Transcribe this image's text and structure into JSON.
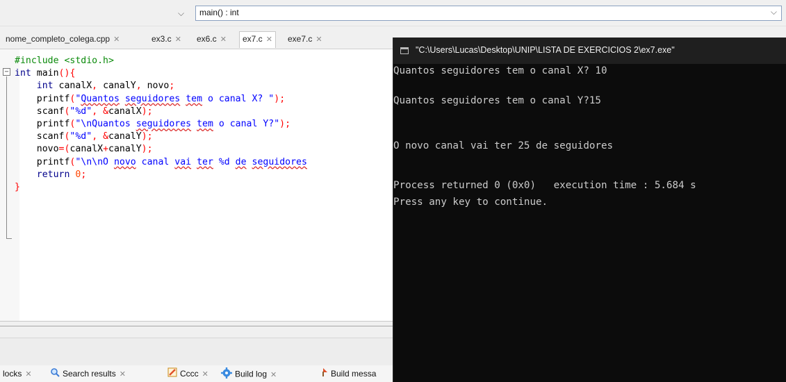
{
  "toolbar": {
    "function_select_value": "main() : int"
  },
  "file_tabs": [
    {
      "label": "nome_completo_colega.cpp",
      "close": "✕"
    },
    {
      "label": "ex3.c",
      "close": "✕"
    },
    {
      "label": "ex6.c",
      "close": "✕"
    },
    {
      "label": "ex7.c",
      "close": "✕",
      "active": true
    },
    {
      "label": "exe7.c",
      "close": "✕"
    }
  ],
  "code_lines": [
    "#include <stdio.h>",
    "int main(){",
    "    int canalX, canalY, novo;",
    "    printf(\"Quantos seguidores tem o canal X? \");",
    "    scanf(\"%d\", &canalX);",
    "    printf(\"\\nQuantos seguidores tem o canal Y?\");",
    "    scanf(\"%d\", &canalY);",
    "    novo=(canalX+canalY);",
    "    printf(\"\\n\\nO novo canal vai ter %d de seguidores",
    "    return 0;",
    "}"
  ],
  "bottom_tabs": [
    {
      "label": "locks",
      "close": "✕",
      "icon": "none"
    },
    {
      "label": "Search results",
      "close": "✕",
      "icon": "search-icon"
    },
    {
      "label": "Cccc",
      "close": "✕",
      "icon": "pencil-icon"
    },
    {
      "label": "Build log",
      "close": "✕",
      "icon": "gear-icon"
    },
    {
      "label": "Build messa",
      "close": "",
      "icon": "build-message-icon"
    }
  ],
  "console": {
    "title": "\"C:\\Users\\Lucas\\Desktop\\UNIP\\LISTA DE EXERCICIOS 2\\ex7.exe\"",
    "lines": [
      "Quantos seguidores tem o canal X? 10",
      "Quantos seguidores tem o canal Y?15",
      "O novo canal vai ter 25 de seguidores",
      "Process returned 0 (0x0)   execution time : 5.684 s",
      "Press any key to continue."
    ]
  },
  "colors": {
    "preprocessor": "#0a8a0a",
    "keyword": "#00008b",
    "string": "#0000ff",
    "number": "#ff4500",
    "console_bg": "#0c0c0c",
    "console_text": "#cccccc"
  }
}
